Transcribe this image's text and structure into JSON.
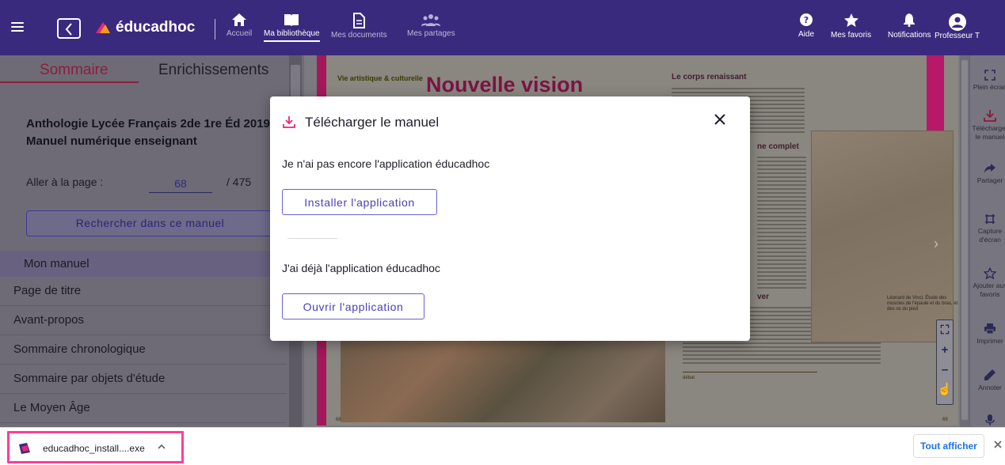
{
  "colors": {
    "nav_bg": "#3a2a7e",
    "brand_pink": "#e8267a",
    "accent_purple": "#4a3fb5",
    "download_highlight": "#ff3d9a",
    "link_blue": "#1a73e8"
  },
  "nav": {
    "brand": "éducadhoc",
    "items": [
      {
        "label": "Accueil",
        "icon": "home-icon"
      },
      {
        "label": "Ma bibliothèque",
        "icon": "book-open-icon",
        "active": true
      },
      {
        "label": "Mes documents",
        "icon": "document-icon"
      },
      {
        "label": "Mes partages",
        "icon": "share-people-icon"
      }
    ],
    "right": [
      {
        "label": "Aide",
        "icon": "help-icon"
      },
      {
        "label": "Mes favoris",
        "icon": "star-icon"
      },
      {
        "label": "Notifications",
        "icon": "bell-icon"
      },
      {
        "label": "Professeur T",
        "icon": "user-avatar-icon"
      }
    ]
  },
  "sidebar": {
    "tabs": [
      "Sommaire",
      "Enrichissements"
    ],
    "book_title": "Anthologie Lycée Français 2de 1re Éd 2019 Manuel numérique enseignant",
    "goto_label": "Aller à la page :",
    "goto_value": "68",
    "goto_total": "/ 475",
    "search_button": "Rechercher dans ce manuel",
    "toc_header": "Mon manuel",
    "toc": [
      "Page de titre",
      "Avant-propos",
      "Sommaire chronologique",
      "Sommaire par objets d'étude",
      "Le Moyen Âge"
    ]
  },
  "page": {
    "tag": "Vie artistique & culturelle",
    "title": "Nouvelle vision",
    "heading1": "Le corps renaissant",
    "heading2": "ne complet",
    "heading3": "ver",
    "caption": "Léonard de Vinci, Étude des muscles de l'épaule et du bras, et des os du pied",
    "box_title": "débat",
    "page_left": "68",
    "page_right": "69"
  },
  "right_toolbar": [
    {
      "label": "Plein écran",
      "icon": "fullscreen-icon"
    },
    {
      "label": "Télécharger le manuel",
      "icon": "download-icon"
    },
    {
      "label": "Partager",
      "icon": "share-arrow-icon"
    },
    {
      "label": "Capture d'écran",
      "icon": "capture-icon"
    },
    {
      "label": "Ajouter aux favoris",
      "icon": "star-outline-icon"
    },
    {
      "label": "Imprimer",
      "icon": "print-icon"
    },
    {
      "label": "Annoter",
      "icon": "pen-icon"
    },
    {
      "label": "",
      "icon": "microphone-icon"
    }
  ],
  "modal": {
    "title": "Télécharger le manuel",
    "question1": "Je n'ai pas encore l'application éducadhoc",
    "install_button": "Installer l'application",
    "question2": "J'ai déjà l'application éducadhoc",
    "open_button": "Ouvrir l'application"
  },
  "downloads": {
    "file_name": "educadhoc_install....exe",
    "show_all": "Tout afficher"
  }
}
